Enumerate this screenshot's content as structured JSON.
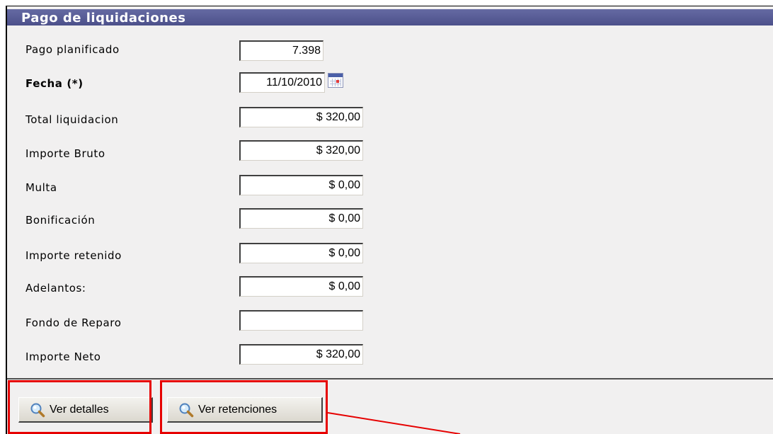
{
  "panel": {
    "title": "Pago de liquidaciones"
  },
  "fields": [
    {
      "label": "Pago planificado",
      "value": "7.398",
      "bold": false
    },
    {
      "label": "Fecha (*)",
      "value": "11/10/2010",
      "bold": true
    },
    {
      "label": "Total liquidacion",
      "value": "$ 320,00",
      "bold": false
    },
    {
      "label": "Importe Bruto",
      "value": "$ 320,00",
      "bold": false
    },
    {
      "label": "Multa",
      "value": "$ 0,00",
      "bold": false
    },
    {
      "label": "Bonificación",
      "value": "$ 0,00",
      "bold": false
    },
    {
      "label": "Importe retenido",
      "value": "$ 0,00",
      "bold": false
    },
    {
      "label": "Adelantos:",
      "value": "$ 0,00",
      "bold": false
    },
    {
      "label": "Fondo de Reparo",
      "value": "",
      "bold": false
    },
    {
      "label": "Importe Neto",
      "value": "$ 320,00",
      "bold": false
    }
  ],
  "buttons": {
    "ver_detalles": "Ver detalles",
    "ver_retenciones": "Ver retenciones"
  },
  "icons": {
    "calendar": "calendar-icon",
    "buttons": "magnifier-icon"
  },
  "colors": {
    "title_bar": "#5a5e99",
    "highlight": "#e60000",
    "panel_bg": "#f1f0f0"
  }
}
